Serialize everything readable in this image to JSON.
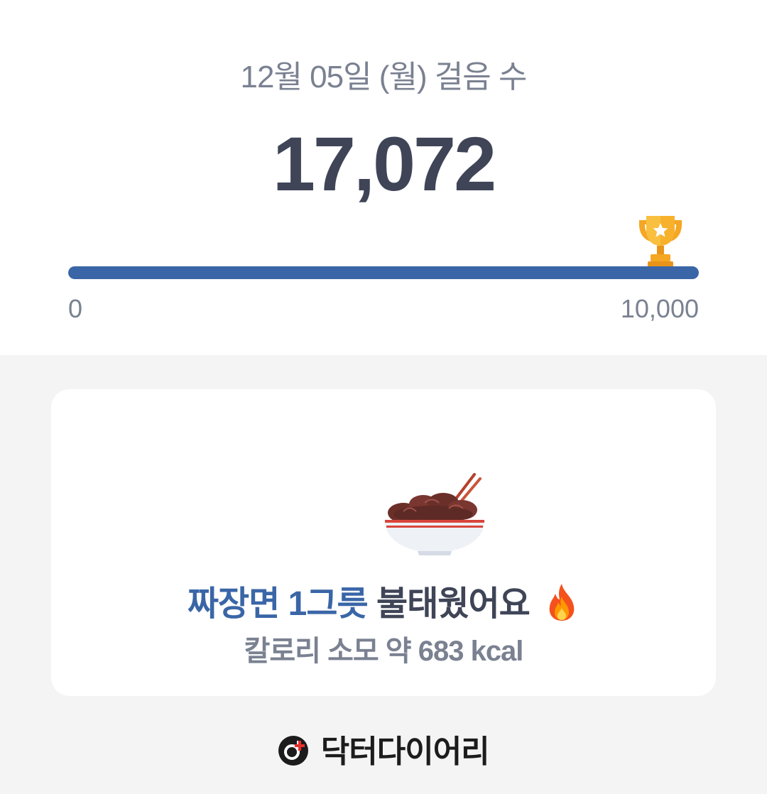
{
  "header": {
    "date_title": "12월 05일 (월) 걸음 수",
    "steps": "17,072"
  },
  "progress": {
    "current": 17072,
    "goal": 10000,
    "fraction": 1.0,
    "min_label": "0",
    "max_label": "10,000",
    "fill_color": "#3a66a7",
    "goal_icon": "trophy-icon"
  },
  "summary": {
    "food_icon": "noodle-bowl-icon",
    "food_text": "짜장면 1그릇",
    "burn_text": "불태웠어요",
    "fire_icon": "fire-icon",
    "kcal_text": "칼로리 소모 약 683 kcal",
    "accent_color": "#3a66a7"
  },
  "brand": {
    "logo_icon": "doctor-diary-logo",
    "name": "닥터다이어리"
  }
}
